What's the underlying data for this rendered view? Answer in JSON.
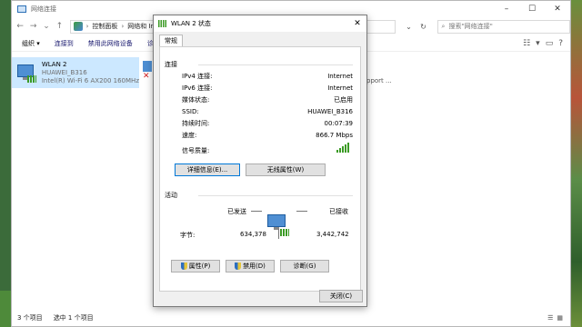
{
  "explorer": {
    "title": "网络连接",
    "breadcrumb": [
      "控制面板",
      "网络和 Internet"
    ],
    "search_placeholder": "搜索\"网络连接\"",
    "commands": [
      "组织 ▾",
      "连接到",
      "禁用此网络设备",
      "诊断"
    ],
    "items": [
      {
        "name": "WLAN 2",
        "network": "HUAWEI_B316",
        "adapter": "Intel(R) Wi-Fi 6 AX200 160MHz"
      }
    ],
    "support_text": "pport ...",
    "status": {
      "count": "3 个项目",
      "selected": "选中 1 个项目"
    }
  },
  "dialog": {
    "title": "WLAN 2 状态",
    "tab": "常规",
    "connection": {
      "label": "连接",
      "rows": [
        {
          "label": "IPv4 连接:",
          "value": "Internet"
        },
        {
          "label": "IPv6 连接:",
          "value": "Internet"
        },
        {
          "label": "媒体状态:",
          "value": "已启用"
        },
        {
          "label": "SSID:",
          "value": "HUAWEI_B316"
        },
        {
          "label": "持续时间:",
          "value": "00:07:39"
        },
        {
          "label": "速度:",
          "value": "866.7 Mbps"
        }
      ],
      "signal_label": "信号质量:",
      "signal_level": 1.0,
      "details_button": "详细信息(E)...",
      "wireless_button": "无线属性(W)"
    },
    "activity": {
      "label": "活动",
      "sent_label": "已发送",
      "received_label": "已接收",
      "bytes_label": "字节:",
      "sent_bytes": "634,378",
      "received_bytes": "3,442,742"
    },
    "actions": {
      "properties": "属性(P)",
      "disable": "禁用(D)",
      "diagnose": "诊断(G)",
      "close": "关闭(C)"
    }
  }
}
